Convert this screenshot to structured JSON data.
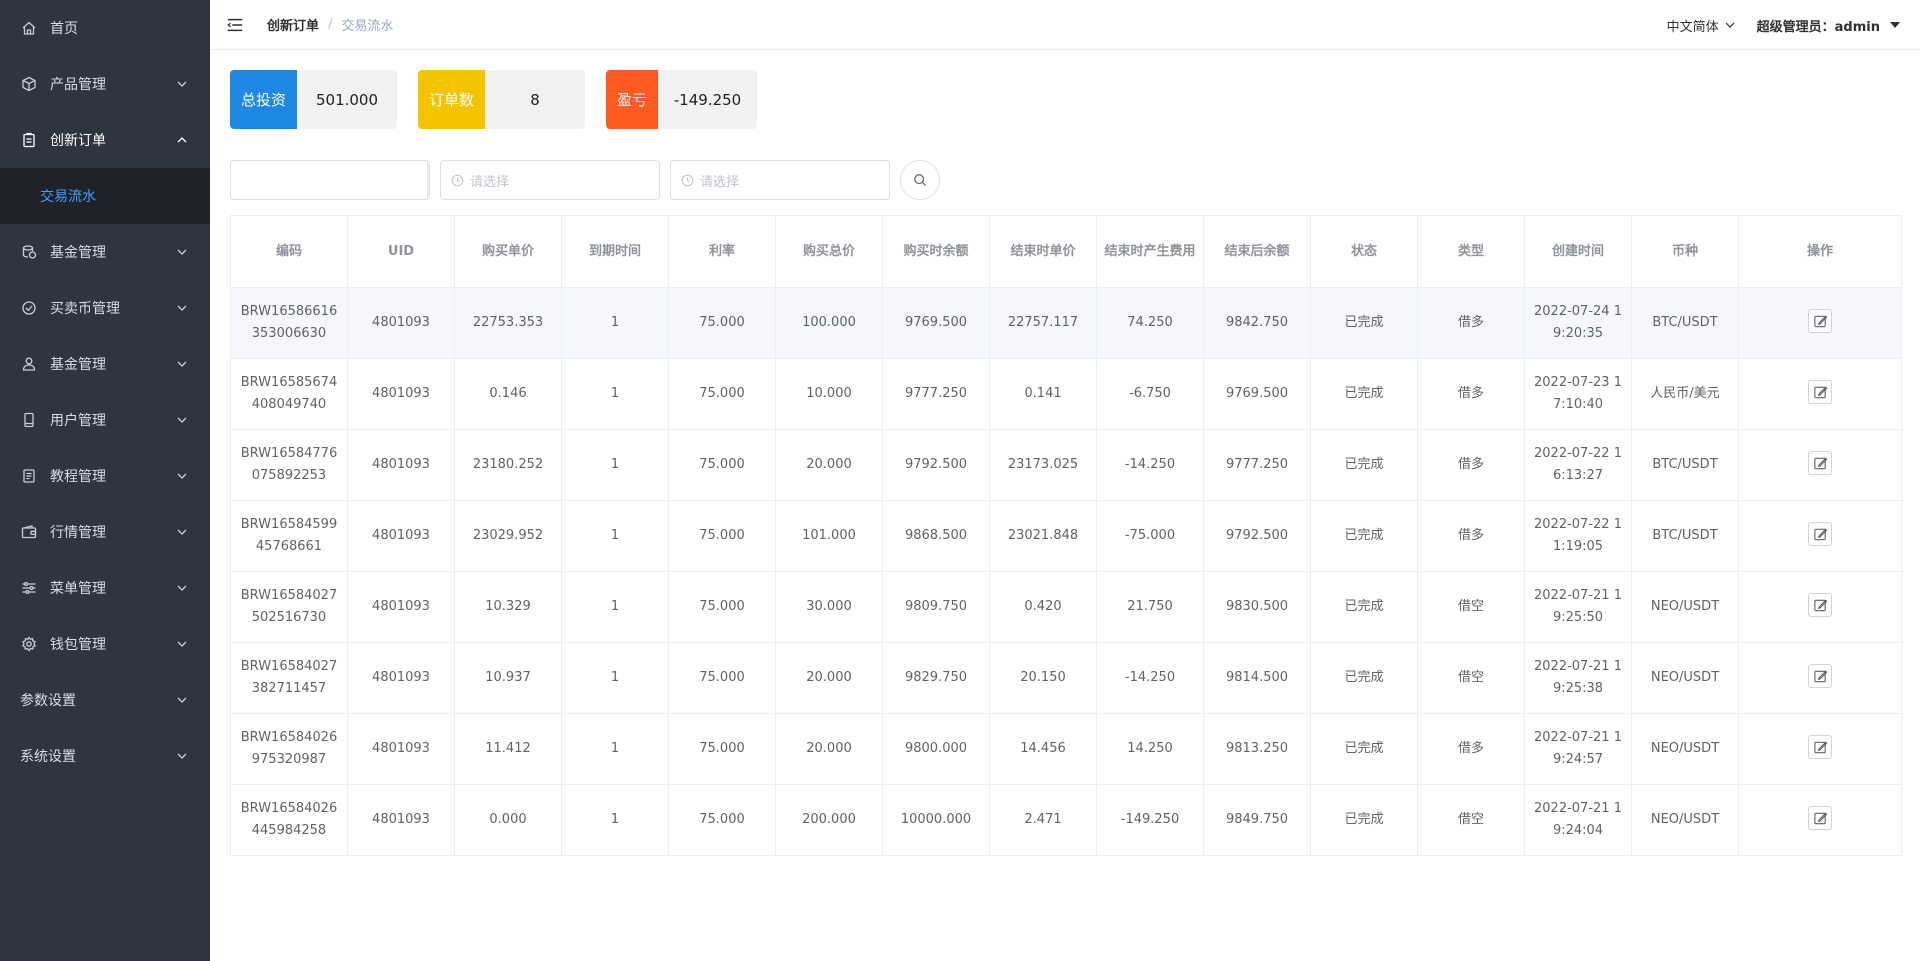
{
  "sidebar": {
    "items": [
      {
        "label": "首页",
        "icon": "home-icon",
        "arrow": false
      },
      {
        "label": "产品管理",
        "icon": "box-icon",
        "arrow": true
      },
      {
        "label": "创新订单",
        "icon": "clipboard-icon",
        "arrow": true,
        "expanded": true
      },
      {
        "label": "基金管理",
        "icon": "coins-icon",
        "arrow": true
      },
      {
        "label": "买卖币管理",
        "icon": "check-circle-icon",
        "arrow": true
      },
      {
        "label": "基金管理",
        "icon": "users-icon",
        "arrow": true
      },
      {
        "label": "用户管理",
        "icon": "phone-icon",
        "arrow": true
      },
      {
        "label": "教程管理",
        "icon": "document-icon",
        "arrow": true
      },
      {
        "label": "行情管理",
        "icon": "wallet-icon",
        "arrow": true
      },
      {
        "label": "菜单管理",
        "icon": "sliders-icon",
        "arrow": true
      },
      {
        "label": "钱包管理",
        "icon": "gear-icon",
        "arrow": true
      },
      {
        "label": "参数设置",
        "icon": "",
        "arrow": true
      },
      {
        "label": "系统设置",
        "icon": "",
        "arrow": true
      }
    ],
    "submenu_active": "交易流水"
  },
  "header": {
    "breadcrumb": [
      "创新订单",
      "交易流水"
    ],
    "language": "中文简体",
    "user": "超级管理员：admin"
  },
  "stats": [
    {
      "label": "总投资",
      "value": "501.000",
      "color": "#1e88e5"
    },
    {
      "label": "订单数",
      "value": "8",
      "color": "#f5c400"
    },
    {
      "label": "盈亏",
      "value": "-149.250",
      "color": "#ff5a1f"
    }
  ],
  "filters": {
    "search_value": "",
    "start_placeholder": "请选择",
    "end_placeholder": "请选择"
  },
  "table": {
    "columns": [
      "编码",
      "UID",
      "购买单价",
      "到期时间",
      "利率",
      "购买总价",
      "购买时余额",
      "结束时单价",
      "结束时产生费用",
      "结束后余额",
      "状态",
      "类型",
      "创建时间",
      "币种",
      "操作"
    ],
    "rows": [
      [
        "BRW16586616353006630",
        "4801093",
        "22753.353",
        "1",
        "75.000",
        "100.000",
        "9769.500",
        "22757.117",
        "74.250",
        "9842.750",
        "已完成",
        "借多",
        "2022-07-24 19:20:35",
        "BTC/USDT"
      ],
      [
        "BRW16585674408049740",
        "4801093",
        "0.146",
        "1",
        "75.000",
        "10.000",
        "9777.250",
        "0.141",
        "-6.750",
        "9769.500",
        "已完成",
        "借多",
        "2022-07-23 17:10:40",
        "人民币/美元"
      ],
      [
        "BRW16584776075892253",
        "4801093",
        "23180.252",
        "1",
        "75.000",
        "20.000",
        "9792.500",
        "23173.025",
        "-14.250",
        "9777.250",
        "已完成",
        "借多",
        "2022-07-22 16:13:27",
        "BTC/USDT"
      ],
      [
        "BRW1658459945768661",
        "4801093",
        "23029.952",
        "1",
        "75.000",
        "101.000",
        "9868.500",
        "23021.848",
        "-75.000",
        "9792.500",
        "已完成",
        "借多",
        "2022-07-22 11:19:05",
        "BTC/USDT"
      ],
      [
        "BRW16584027502516730",
        "4801093",
        "10.329",
        "1",
        "75.000",
        "30.000",
        "9809.750",
        "0.420",
        "21.750",
        "9830.500",
        "已完成",
        "借空",
        "2022-07-21 19:25:50",
        "NEO/USDT"
      ],
      [
        "BRW16584027382711457",
        "4801093",
        "10.937",
        "1",
        "75.000",
        "20.000",
        "9829.750",
        "20.150",
        "-14.250",
        "9814.500",
        "已完成",
        "借空",
        "2022-07-21 19:25:38",
        "NEO/USDT"
      ],
      [
        "BRW16584026975320987",
        "4801093",
        "11.412",
        "1",
        "75.000",
        "20.000",
        "9800.000",
        "14.456",
        "14.250",
        "9813.250",
        "已完成",
        "借多",
        "2022-07-21 19:24:57",
        "NEO/USDT"
      ],
      [
        "BRW16584026445984258",
        "4801093",
        "0.000",
        "1",
        "75.000",
        "200.000",
        "10000.000",
        "2.471",
        "-149.250",
        "9849.750",
        "已完成",
        "借空",
        "2022-07-21 19:24:04",
        "NEO/USDT"
      ]
    ]
  },
  "colors": {
    "sidebar_bg": "#2f3540",
    "accent": "#409eff",
    "profit": "#2e8b1e",
    "loss": "#e02020"
  }
}
